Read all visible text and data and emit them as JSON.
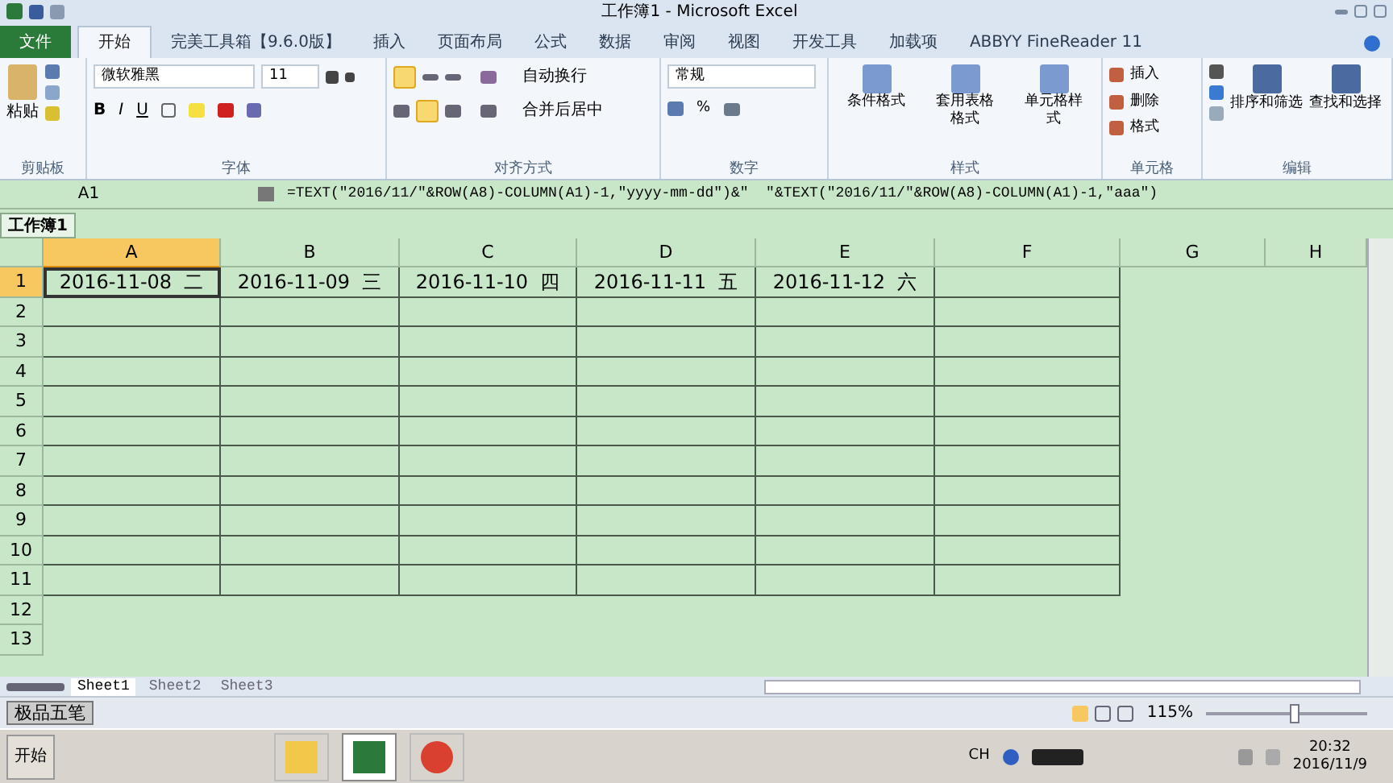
{
  "window": {
    "title": "工作簿1 - Microsoft Excel"
  },
  "ribbon_tabs": [
    {
      "label": "文件",
      "kind": "file",
      "selected": false
    },
    {
      "label": "开始",
      "kind": "tab",
      "selected": true
    },
    {
      "label": "完美工具箱【9.6.0版】",
      "kind": "tab",
      "selected": false
    },
    {
      "label": "插入",
      "kind": "tab",
      "selected": false
    },
    {
      "label": "页面布局",
      "kind": "tab",
      "selected": false
    },
    {
      "label": "公式",
      "kind": "tab",
      "selected": false
    },
    {
      "label": "数据",
      "kind": "tab",
      "selected": false
    },
    {
      "label": "审阅",
      "kind": "tab",
      "selected": false
    },
    {
      "label": "视图",
      "kind": "tab",
      "selected": false
    },
    {
      "label": "开发工具",
      "kind": "tab",
      "selected": false
    },
    {
      "label": "加载项",
      "kind": "tab",
      "selected": false
    },
    {
      "label": "ABBYY FineReader 11",
      "kind": "tab",
      "selected": false
    }
  ],
  "ribbon": {
    "clipboard": {
      "label": "剪贴板",
      "paste": "粘贴"
    },
    "font": {
      "label": "字体",
      "font_name": "微软雅黑",
      "font_size": "11",
      "bold": "B",
      "italic": "I",
      "underline": "U"
    },
    "alignment": {
      "label": "对齐方式",
      "wrap": "自动换行",
      "merge": "合并后居中",
      "top_align_on": true,
      "center_on": true
    },
    "number": {
      "label": "数字",
      "format": "常规",
      "percent": "%"
    },
    "styles": {
      "label": "样式",
      "buttons": [
        "条件格式",
        "套用表格格式",
        "单元格样式"
      ]
    },
    "cells": {
      "label": "单元格",
      "buttons": [
        "插入",
        "删除",
        "格式"
      ]
    },
    "editing": {
      "label": "编辑",
      "buttons": [
        "排序和筛选",
        "查找和选择"
      ]
    }
  },
  "formula_bar": {
    "name_box": "A1",
    "formula": "=TEXT(\"2016/11/\"&ROW(A8)-COLUMN(A1)-1,\"yyyy-mm-dd\")&\"  \"&TEXT(\"2016/11/\"&ROW(A8)-COLUMN(A1)-1,\"aaa\")"
  },
  "workbook_tab": {
    "label": "工作簿1"
  },
  "sheet": {
    "columns": [
      {
        "label": "A",
        "selected": true
      },
      {
        "label": "B",
        "selected": false
      },
      {
        "label": "C",
        "selected": false
      },
      {
        "label": "D",
        "selected": false
      },
      {
        "label": "E",
        "selected": false
      },
      {
        "label": "F",
        "selected": false
      },
      {
        "label": "G",
        "selected": false
      },
      {
        "label": "H",
        "selected": false
      }
    ],
    "rows": [
      {
        "label": "1",
        "selected": true,
        "cells": [
          "2016-11-08  二",
          "2016-11-09  三",
          "2016-11-10  四",
          "2016-11-11  五",
          "2016-11-12  六"
        ]
      },
      {
        "label": "2",
        "selected": false
      },
      {
        "label": "3",
        "selected": false
      },
      {
        "label": "4",
        "selected": false
      },
      {
        "label": "5",
        "selected": false
      },
      {
        "label": "6",
        "selected": false
      },
      {
        "label": "7",
        "selected": false
      },
      {
        "label": "8",
        "selected": false
      },
      {
        "label": "9",
        "selected": false
      },
      {
        "label": "10",
        "selected": false
      },
      {
        "label": "11",
        "selected": false
      },
      {
        "label": "12",
        "selected": false
      },
      {
        "label": "13",
        "selected": false
      }
    ]
  },
  "sheet_tabs": [
    {
      "label": "Sheet1",
      "selected": true
    },
    {
      "label": "Sheet2",
      "selected": false
    },
    {
      "label": "Sheet3",
      "selected": false
    }
  ],
  "status_bar": {
    "zoom": "115%",
    "level": 0.55
  },
  "ime_bar": {
    "label": "极品五笔"
  },
  "taskbar": {
    "start": "开始",
    "apps": [
      {
        "kind": "folder",
        "selected": false
      },
      {
        "kind": "excel",
        "selected": true
      },
      {
        "kind": "browser",
        "selected": false
      }
    ],
    "language": "CH",
    "time": "20:32",
    "date": "2016/11/9"
  }
}
